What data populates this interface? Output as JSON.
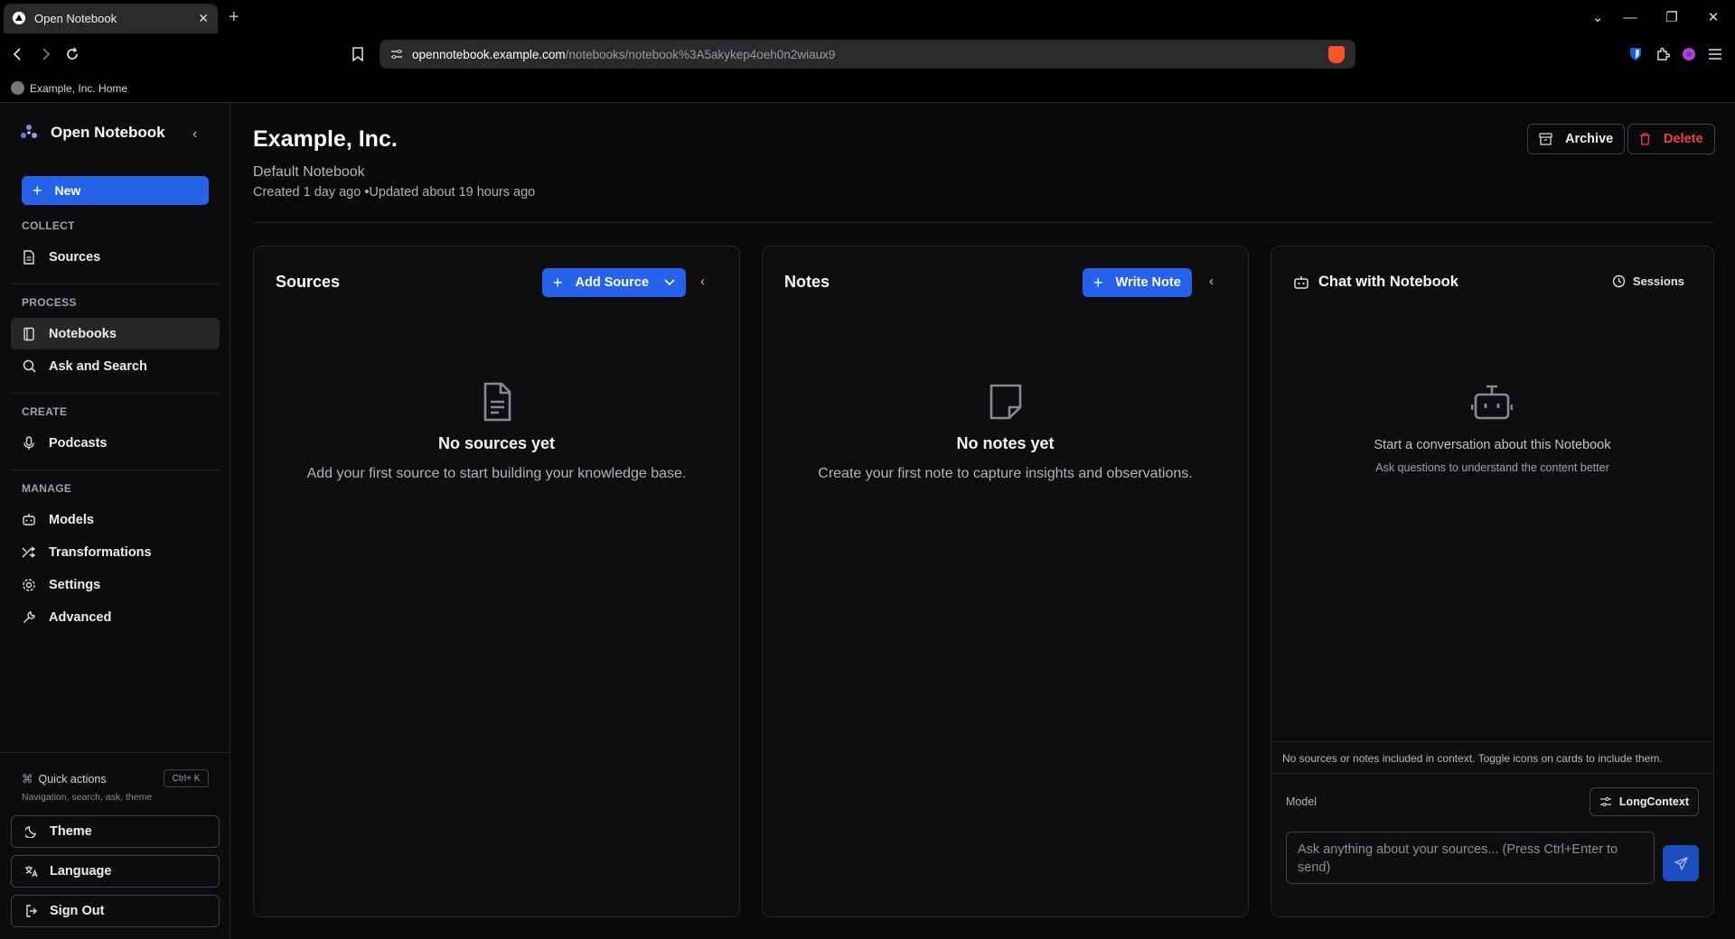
{
  "browser": {
    "tab_title": "Open Notebook",
    "url_host": "opennotebook.example.com",
    "url_path": "/notebooks/notebook%3A5akykep4oeh0n2wiaux9",
    "bookmark_label": "Example, Inc. Home"
  },
  "sidebar": {
    "brand": "Open Notebook",
    "new_label": "New",
    "sections": {
      "collect": "COLLECT",
      "process": "PROCESS",
      "create": "CREATE",
      "manage": "MANAGE"
    },
    "items": {
      "sources": "Sources",
      "notebooks": "Notebooks",
      "ask_search": "Ask and Search",
      "podcasts": "Podcasts",
      "models": "Models",
      "transformations": "Transformations",
      "settings": "Settings",
      "advanced": "Advanced"
    },
    "quick_actions": "Quick actions",
    "quick_actions_kbd": "Ctrl+ K",
    "quick_actions_sub": "Navigation, search, ask, theme",
    "theme": "Theme",
    "language": "Language",
    "sign_out": "Sign Out"
  },
  "notebook": {
    "title": "Example, Inc.",
    "description": "Default Notebook",
    "meta": "Created 1 day ago •Updated about 19 hours ago",
    "archive_label": "Archive",
    "delete_label": "Delete"
  },
  "sources_panel": {
    "title": "Sources",
    "add_label": "Add Source",
    "empty_title": "No sources yet",
    "empty_sub": "Add your first source to start building your knowledge base."
  },
  "notes_panel": {
    "title": "Notes",
    "write_label": "Write Note",
    "empty_title": "No notes yet",
    "empty_sub": "Create your first note to capture insights and observations."
  },
  "chat_panel": {
    "title": "Chat with Notebook",
    "sessions_label": "Sessions",
    "empty_title": "Start a conversation about this Notebook",
    "empty_sub": "Ask questions to understand the content better",
    "context_note": "No sources or notes included in context. Toggle icons on cards to include them.",
    "model_label": "Model",
    "model_value": "LongContext",
    "input_placeholder": "Ask anything about your sources... (Press Ctrl+Enter to send)",
    "input_value": ""
  },
  "colors": {
    "accent": "#2563eb",
    "danger": "#ef4444",
    "background": "#09090b"
  }
}
